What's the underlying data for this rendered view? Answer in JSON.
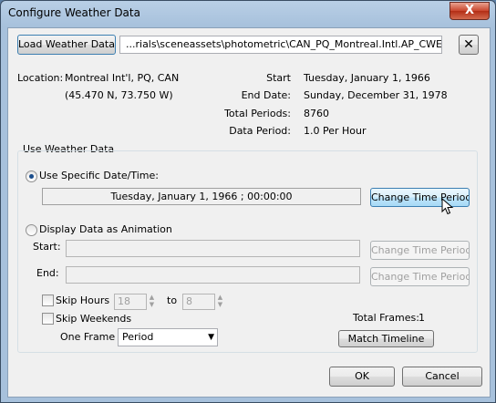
{
  "window": {
    "title": "Configure Weather Data",
    "close_glyph": "X"
  },
  "file": {
    "load_button": "Load Weather Data...",
    "path": "...rials\\sceneassets\\photometric\\CAN_PQ_Montreal.Intl.AP_CWEC.epw",
    "clear_glyph": "✕"
  },
  "location": {
    "label": "Location:",
    "name": "Montreal Int'l, PQ, CAN",
    "coords": "(45.470 N, 73.750 W)"
  },
  "info": {
    "start_label": "Start",
    "start_value": "Tuesday, January 1, 1966",
    "end_label": "End Date:",
    "end_value": "Sunday, December 31, 1978",
    "periods_label": "Total Periods:",
    "periods_value": "8760",
    "data_period_label": "Data Period:",
    "data_period_value": "1.0 Per Hour"
  },
  "group": {
    "title": "Use Weather Data"
  },
  "specific": {
    "label": "Use Specific Date/Time:",
    "value": "Tuesday, January 1, 1966 ; 00:00:00",
    "change_button": "Change Time Period..."
  },
  "animation": {
    "label": "Display Data as  Animation",
    "start_label": "Start:",
    "end_label": "End:",
    "change_start_button": "Change Time Period...",
    "change_end_button": "Change Time Period..."
  },
  "skip": {
    "hours_label": "Skip Hours",
    "from_value": "18",
    "to_label": "to",
    "to_value": "8",
    "weekends_label": "Skip Weekends"
  },
  "frames": {
    "total_label": "Total Frames:",
    "total_value": "1",
    "one_frame_label": "One Frame",
    "one_frame_value": "Period",
    "match_button": "Match Timeline"
  },
  "footer": {
    "ok": "OK",
    "cancel": "Cancel"
  }
}
